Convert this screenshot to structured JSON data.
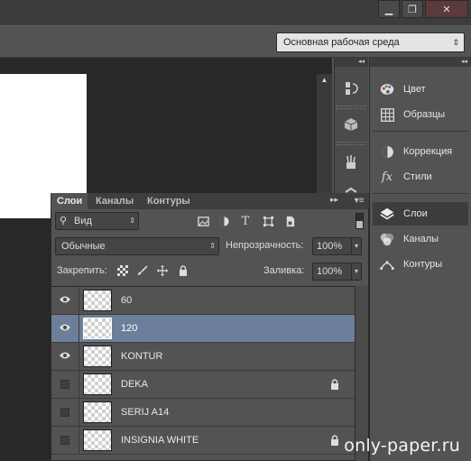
{
  "window": {
    "minimize_glyph": "▁",
    "restore_glyph": "❐",
    "close_glyph": "✕"
  },
  "workspace": {
    "selected": "Основная рабочая среда"
  },
  "dock": {
    "items": [
      {
        "label": "Цвет",
        "icon": "palette-icon"
      },
      {
        "label": "Образцы",
        "icon": "swatches-grid-icon"
      },
      {
        "label": "Коррекция",
        "icon": "adjustment-circle-icon"
      },
      {
        "label": "Стили",
        "icon": "fx-styles-icon"
      },
      {
        "label": "Слои",
        "icon": "layers-stack-icon"
      },
      {
        "label": "Каналы",
        "icon": "channels-circles-icon"
      },
      {
        "label": "Контуры",
        "icon": "paths-pen-icon"
      }
    ]
  },
  "layers_panel": {
    "tabs": [
      "Слои",
      "Каналы",
      "Контуры"
    ],
    "kind_filter": "Вид",
    "blend_mode": "Обычные",
    "opacity_label": "Непрозрачность:",
    "opacity_value": "100%",
    "lock_label": "Закрепить:",
    "fill_label": "Заливка:",
    "fill_value": "100%",
    "layers": [
      {
        "name": "60",
        "visible": true,
        "selected": false,
        "locked": false
      },
      {
        "name": "120",
        "visible": true,
        "selected": true,
        "locked": false
      },
      {
        "name": "KONTUR",
        "visible": true,
        "selected": false,
        "locked": false
      },
      {
        "name": "DEKA",
        "visible": false,
        "selected": false,
        "locked": true
      },
      {
        "name": "SERIJ A14",
        "visible": false,
        "selected": false,
        "locked": false
      },
      {
        "name": "INSIGNIA WHITE",
        "visible": false,
        "selected": false,
        "locked": true
      }
    ]
  },
  "watermark": "only-paper.ru"
}
